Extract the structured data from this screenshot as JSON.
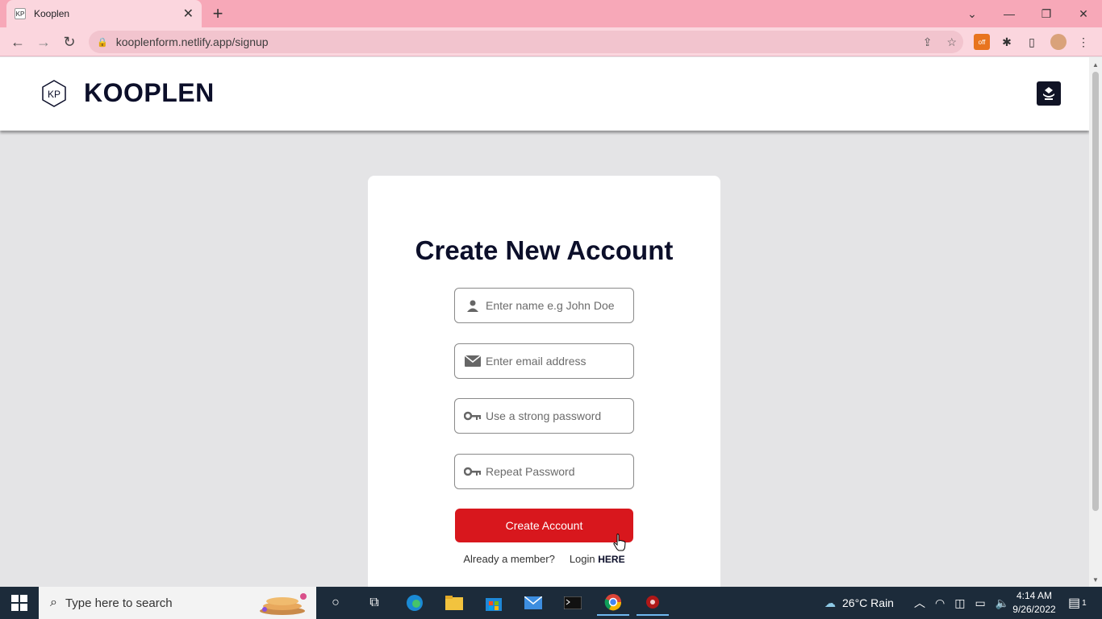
{
  "browser": {
    "tab_title": "Kooplen",
    "tab_favicon": "KP",
    "url": "kooplenform.netlify.app/signup",
    "extension_badge": "off",
    "colors": {
      "tabbar": "#f7a8b8",
      "toolbar": "#fbd6de"
    }
  },
  "site": {
    "logo_text": "KP",
    "brand": "KOOPLEN",
    "menu_icon": "menu-icon"
  },
  "form": {
    "heading": "Create New Account",
    "name_placeholder": "Enter name e.g John Doe",
    "email_placeholder": "Enter email address",
    "password_placeholder": "Use a strong password",
    "repeat_placeholder": "Repeat Password",
    "submit_label": "Create Account",
    "already_member": "Already a member?",
    "login_text": "Login",
    "login_link": "HERE",
    "colors": {
      "primary": "#d8171d",
      "heading": "#0c0f2a"
    }
  },
  "taskbar": {
    "search_placeholder": "Type here to search",
    "weather": "26°C  Rain",
    "time": "4:14 AM",
    "date": "9/26/2022",
    "notification_count": "1"
  }
}
